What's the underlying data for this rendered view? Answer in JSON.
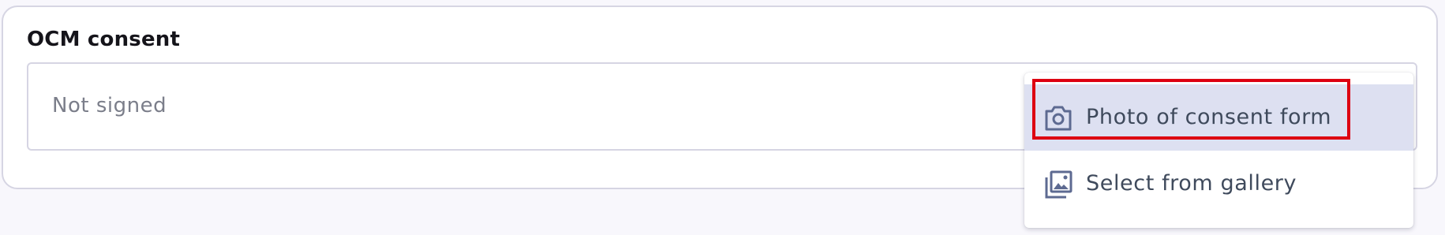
{
  "card": {
    "title": "OCM consent",
    "status_value": "Not signed"
  },
  "menu": {
    "items": [
      {
        "label": "Photo of consent form",
        "icon": "camera-icon",
        "selected": true
      },
      {
        "label": "Select from gallery",
        "icon": "gallery-icon",
        "selected": false
      }
    ]
  },
  "colors": {
    "page_background": "#f8f7fc",
    "selected_item": "#dde0f1",
    "highlight_border": "#dd0011",
    "icon": "#5d6a91"
  }
}
